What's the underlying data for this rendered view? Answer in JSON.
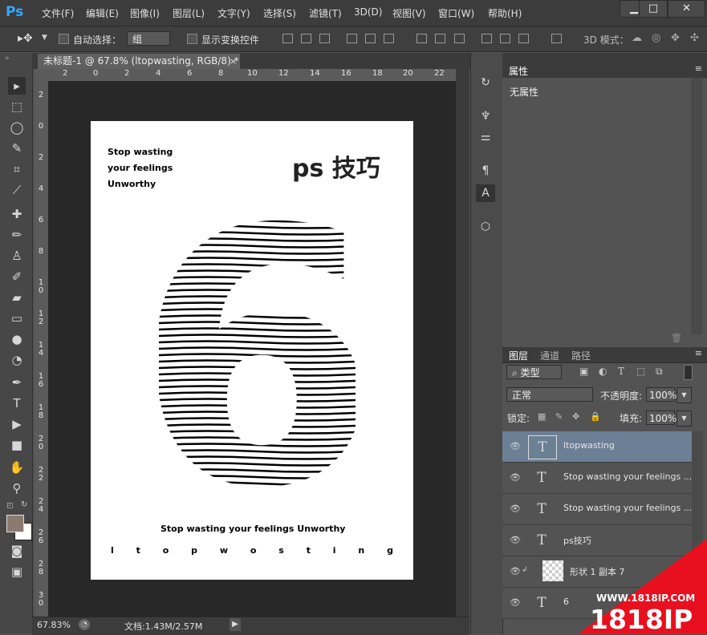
{
  "app": {
    "logo": "Ps"
  },
  "menu": [
    "文件(F)",
    "编辑(E)",
    "图像(I)",
    "图层(L)",
    "文字(Y)",
    "选择(S)",
    "滤镜(T)",
    "3D(D)",
    "视图(V)",
    "窗口(W)",
    "帮助(H)"
  ],
  "window_controls": {
    "minimize": "▁",
    "maximize": "□",
    "close": "✕"
  },
  "options": {
    "auto_select_label": "自动选择：",
    "auto_select_value": "组",
    "show_transform_label": "显示变换控件",
    "mode_3d_label": "3D 模式："
  },
  "document_tab": {
    "title": "未标题-1 @ 67.8% (ltopwasting, RGB/8) *",
    "close": "×"
  },
  "ruler": {
    "h_labels": [
      "2",
      "0",
      "2",
      "4",
      "6",
      "8",
      "10",
      "12",
      "14",
      "16",
      "18",
      "20",
      "22"
    ],
    "v_labels": [
      "2",
      "0",
      "2",
      "4",
      "6",
      "8",
      "10",
      "12",
      "14",
      "16",
      "18",
      "20",
      "22",
      "24",
      "26",
      "28",
      "30"
    ]
  },
  "document": {
    "line1": "Stop wasting",
    "line2": "your feelings",
    "line3": "Unworthy",
    "title": "ps 技巧",
    "big_digit": "6",
    "footer": "Stop wasting your feelings Unworthy",
    "spaced_letters": [
      "l",
      "t",
      "o",
      "p",
      "w",
      "o",
      "s",
      "t",
      "i",
      "n",
      "g"
    ]
  },
  "status": {
    "zoom": "67.83%",
    "doc_info": "文档:1.43M/2.57M"
  },
  "properties": {
    "tab": "属性",
    "content": "无属性"
  },
  "layers_panel": {
    "tabs": [
      "图层",
      "通道",
      "路径"
    ],
    "filter_label": "类型",
    "blend_mode": "正常",
    "opacity_label": "不透明度:",
    "opacity_value": "100%",
    "lock_label": "锁定:",
    "fill_label": "填充:",
    "fill_value": "100%",
    "layers": [
      {
        "name": "ltopwasting",
        "type": "text",
        "selected": true
      },
      {
        "name": "Stop wasting your feelings ...",
        "type": "text"
      },
      {
        "name": "Stop wasting your feelings ...",
        "type": "text"
      },
      {
        "name": "ps技巧",
        "type": "text"
      },
      {
        "name": "形状 1 副本 7",
        "type": "shape"
      },
      {
        "name": "6",
        "type": "text"
      }
    ]
  },
  "watermark": {
    "url": "WWW.1818IP.COM",
    "brand": "1818IP"
  },
  "colors": {
    "accent": "#31a8ff",
    "selected_layer": "#6b7f95",
    "watermark": "#e8101e"
  }
}
